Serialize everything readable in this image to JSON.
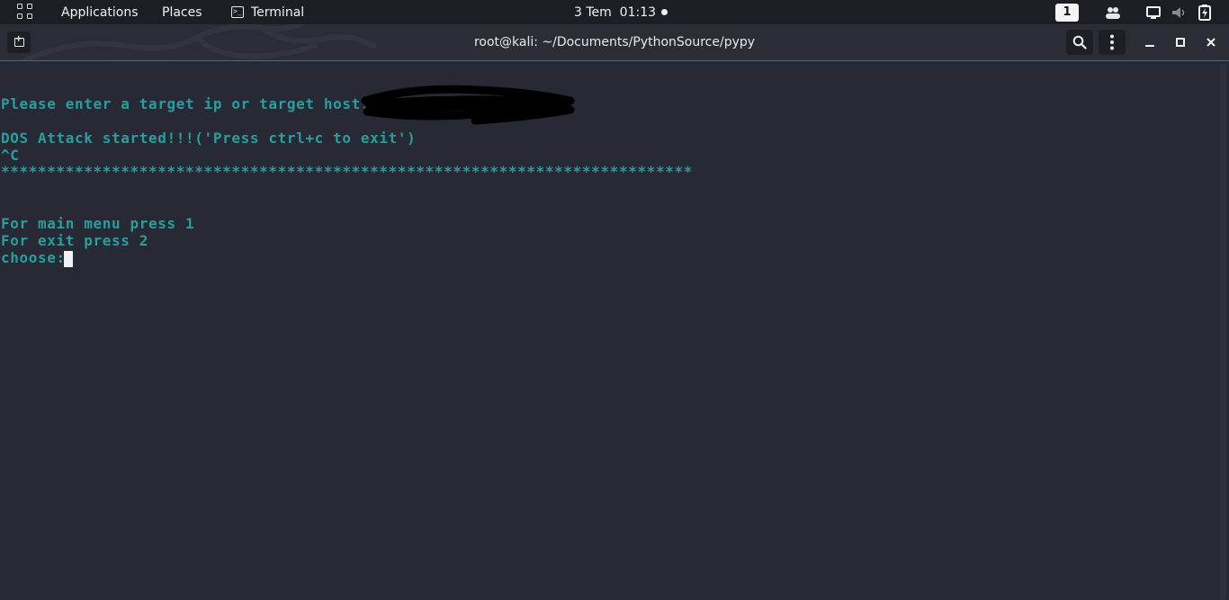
{
  "topbar": {
    "applications_label": "Applications",
    "places_label": "Places",
    "terminal_label": "Terminal",
    "clock": "3 Tem  01:13",
    "workspace_number": "1"
  },
  "window": {
    "title": "root@kali: ~/Documents/PythonSource/pypy"
  },
  "terminal": {
    "lines": [
      "Please enter a target ip or target host:",
      "DOS Attack started!!!('Press ctrl+c to exit')",
      "^C",
      "***************************************************************************",
      "For main menu press 1",
      "For exit press 2",
      "choose:"
    ]
  },
  "colors": {
    "terminal_text": "#2a9d9f",
    "terminal_bg": "#272a34",
    "topbar_bg": "#1c1e23",
    "header_accent": "#3a6ab0"
  },
  "icons": {
    "apps": "grid-icon",
    "terminal": "terminal-icon",
    "new_tab": "new-tab-icon",
    "search": "search-icon",
    "menu": "kebab-menu-icon",
    "minimize": "minimize-icon",
    "maximize": "maximize-icon",
    "close": "close-icon",
    "people": "people-icon",
    "display": "display-icon",
    "volume": "volume-muted-icon",
    "battery": "battery-charging-icon"
  }
}
